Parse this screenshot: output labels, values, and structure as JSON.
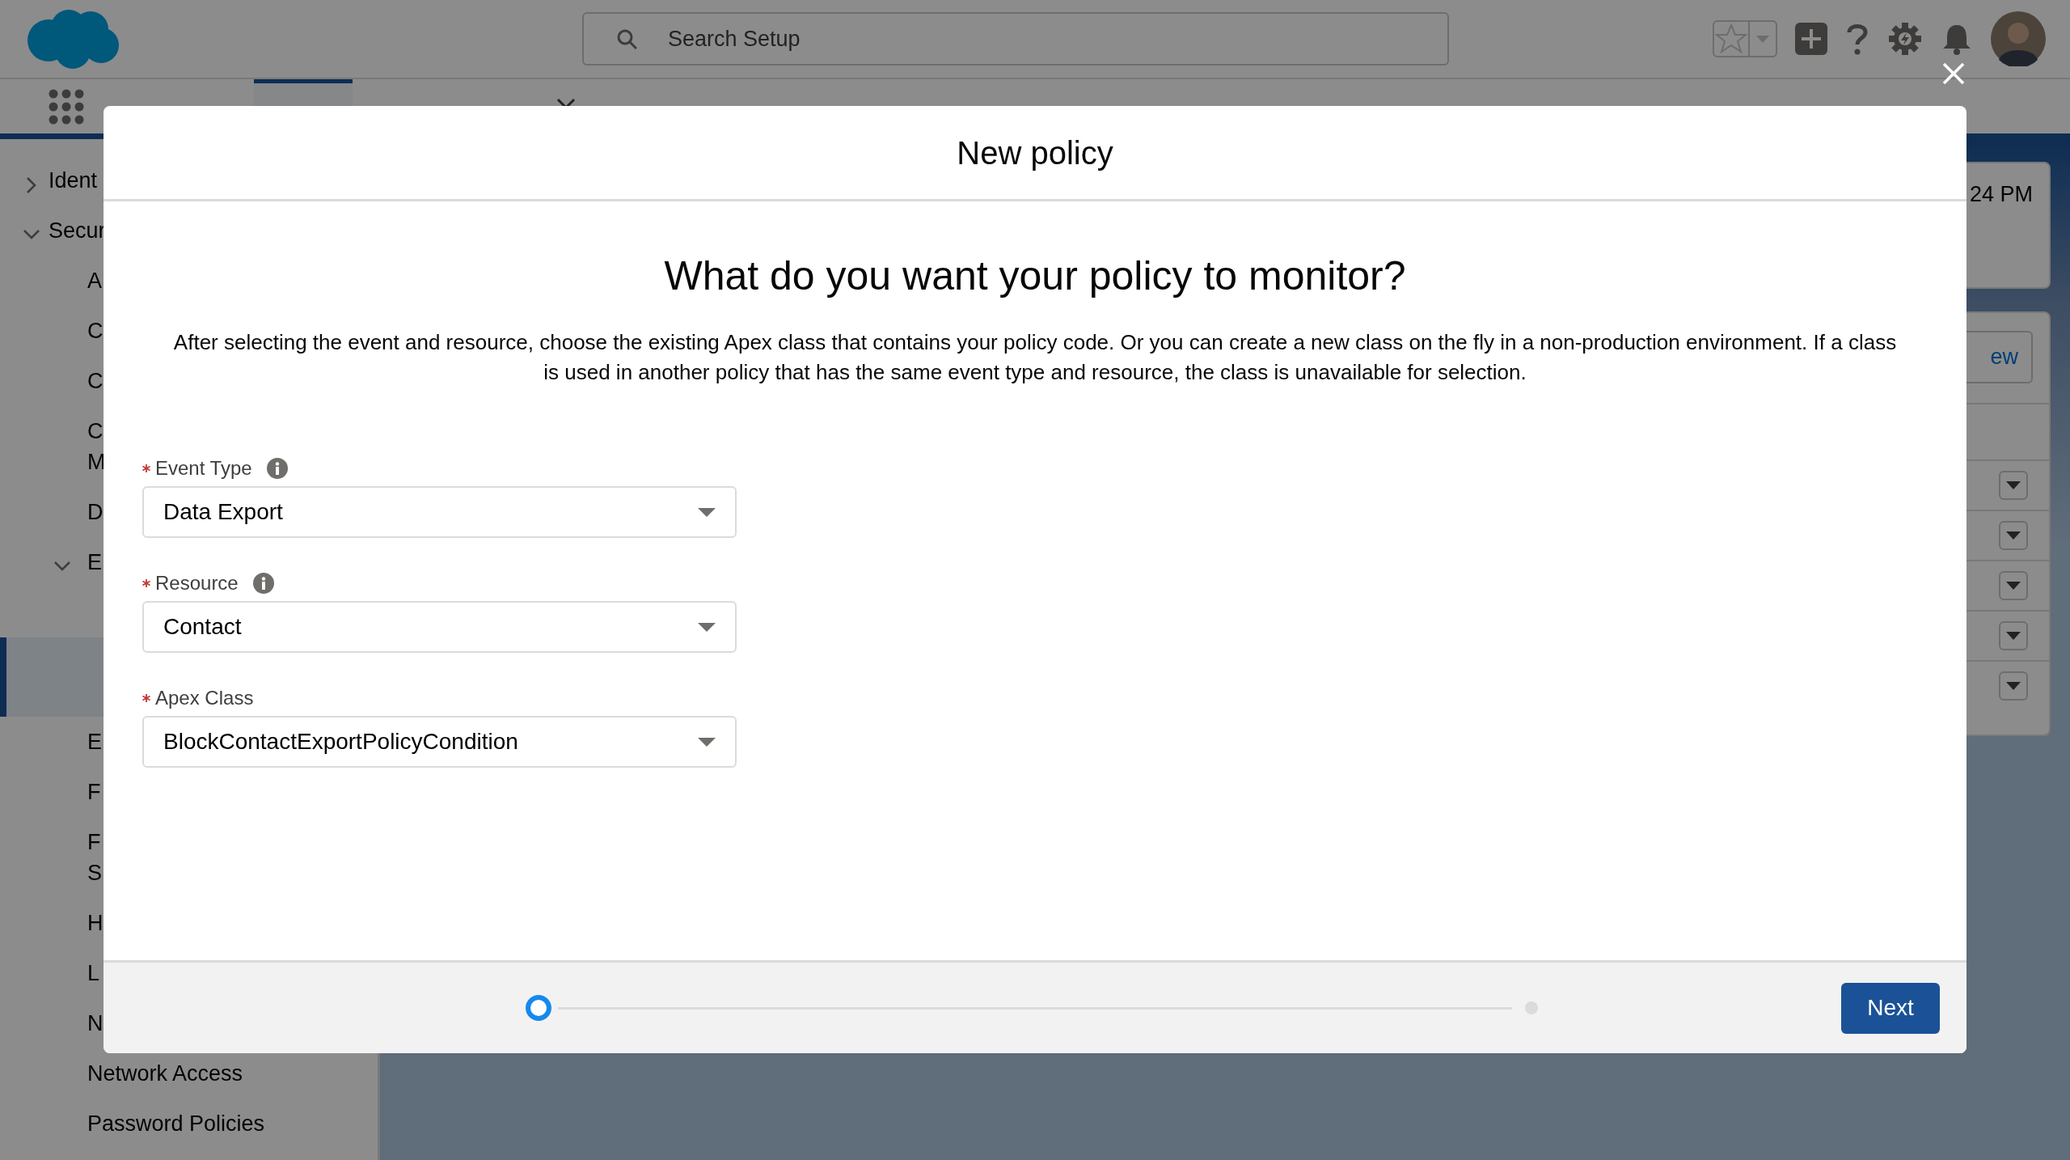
{
  "header": {
    "search": {
      "placeholder": "Search Setup"
    }
  },
  "nav": {
    "tabs": [
      {
        "selected": true
      },
      {
        "selected": false
      }
    ]
  },
  "sidebar": {
    "items": [
      {
        "label": "Ident",
        "expanded": false
      },
      {
        "label": "Secur",
        "expanded": true,
        "children": [
          {
            "label": "A"
          },
          {
            "label": "C"
          },
          {
            "label": "C"
          },
          {
            "label": "C\nM"
          },
          {
            "label": "D"
          },
          {
            "label": "E",
            "expanded": true,
            "children": [
              {
                "selected": true
              }
            ]
          },
          {
            "label": "E"
          },
          {
            "label": "F"
          },
          {
            "label": "F\nS"
          },
          {
            "label": "H"
          },
          {
            "label": "L"
          },
          {
            "label": "N"
          },
          {
            "label": "Network Access"
          },
          {
            "label": "Password Policies"
          }
        ]
      }
    ]
  },
  "background_cards": {
    "time_text": "24 PM",
    "button_text": "ew"
  },
  "modal": {
    "title": "New policy",
    "heading": "What do you want your policy to monitor?",
    "description": "After selecting the event and resource, choose the existing Apex class that contains your policy code. Or you can create a new class on the fly in a non-production environment. If a class is used in another policy that has the same event type and resource, the class is unavailable for selection.",
    "fields": [
      {
        "label": "Event Type",
        "required": true,
        "info": true,
        "value": "Data Export"
      },
      {
        "label": "Resource",
        "required": true,
        "info": true,
        "value": "Contact"
      },
      {
        "label": "Apex Class",
        "required": true,
        "info": false,
        "value": "BlockContactExportPolicyCondition"
      }
    ],
    "progress": [
      {
        "selected": true
      },
      {
        "selected": false
      }
    ],
    "next_button": "Next"
  }
}
